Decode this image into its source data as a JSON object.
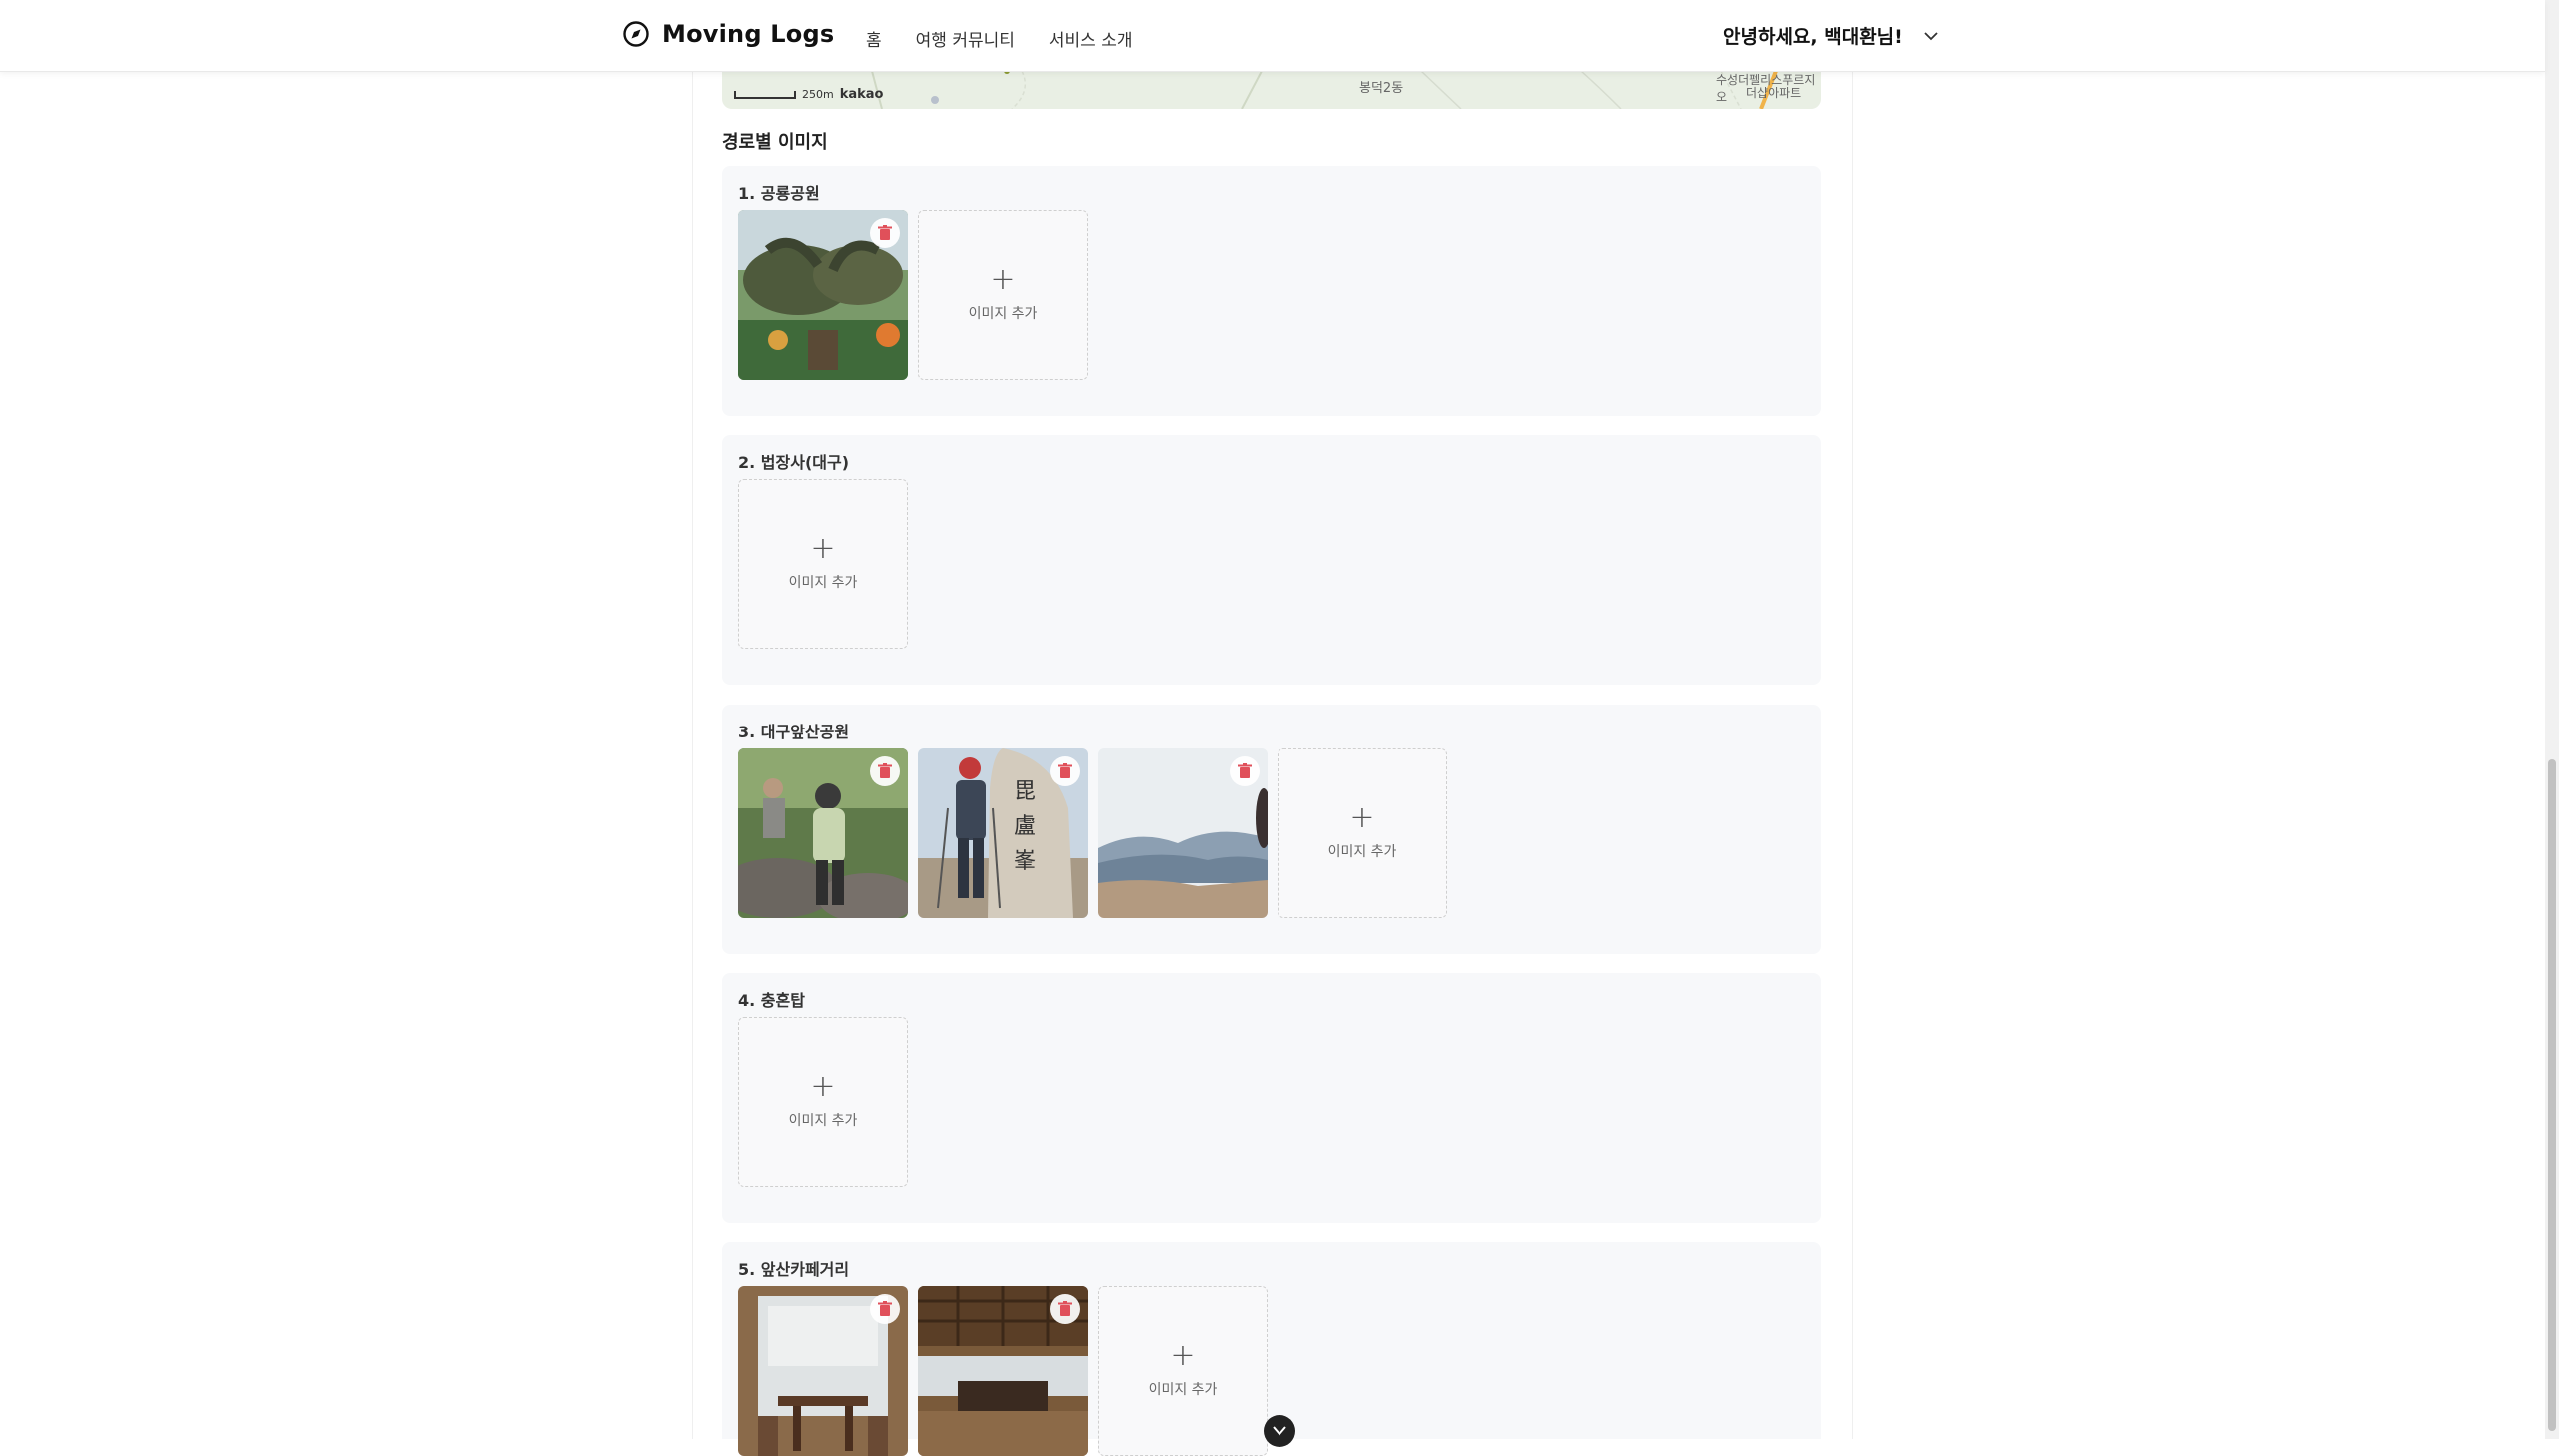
{
  "header": {
    "brand": "Moving Logs",
    "nav": [
      "홈",
      "여행 커뮤니티",
      "서비스 소개"
    ],
    "greeting": "안녕하세요, 백대환님!"
  },
  "map": {
    "scale_label": "250m",
    "provider": "kakao",
    "labels": [
      "봉덕2동",
      "수성더펠리스푸르지오",
      "더샵아파트"
    ]
  },
  "section_title": "경로별 이미지",
  "add_label": "이미지 추가",
  "routes": [
    {
      "title": "1. 공룡공원",
      "images": [
        "dinosaur-park-photo"
      ]
    },
    {
      "title": "2. 법장사(대구)",
      "images": []
    },
    {
      "title": "3. 대구앞산공원",
      "images": [
        "hiking-couple-photo",
        "summit-stone-photo",
        "mountain-view-photo"
      ]
    },
    {
      "title": "4. 충혼탑",
      "images": []
    },
    {
      "title": "5. 앞산카페거리",
      "images": [
        "cafe-window-photo",
        "cafe-interior-photo"
      ]
    }
  ],
  "colors": {
    "delete_icon": "#e0505a",
    "panel_bg": "#f7f8fa"
  }
}
